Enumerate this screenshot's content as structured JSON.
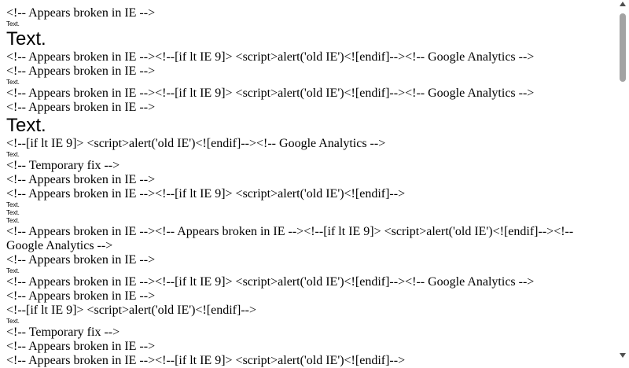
{
  "lines": [
    {
      "style": "serif",
      "text": "<!-- Appears broken in IE -->"
    },
    {
      "style": "tiny",
      "text": "Text."
    },
    {
      "style": "big",
      "text": "Text."
    },
    {
      "style": "serif",
      "text": "<!-- Appears broken in IE --><!--[if lt IE 9]> <script>alert('old IE')<![endif]--><!-- Google Analytics -->"
    },
    {
      "style": "serif",
      "text": "<!-- Appears broken in IE -->"
    },
    {
      "style": "tiny",
      "text": "Text."
    },
    {
      "style": "serif",
      "text": "<!-- Appears broken in IE --><!--[if lt IE 9]> <script>alert('old IE')<![endif]--><!-- Google Analytics -->"
    },
    {
      "style": "serif",
      "text": "<!-- Appears broken in IE -->"
    },
    {
      "style": "big",
      "text": "Text."
    },
    {
      "style": "serif",
      "text": "<!--[if lt IE 9]> <script>alert('old IE')<![endif]--><!-- Google Analytics -->"
    },
    {
      "style": "tiny",
      "text": "Text."
    },
    {
      "style": "serif",
      "text": "<!-- Temporary fix -->"
    },
    {
      "style": "serif",
      "text": "<!-- Appears broken in IE -->"
    },
    {
      "style": "serif",
      "text": "<!-- Appears broken in IE --><!--[if lt IE 9]> <script>alert('old IE')<![endif]-->"
    },
    {
      "style": "tiny",
      "text": "Text."
    },
    {
      "style": "tiny",
      "text": "Text."
    },
    {
      "style": "tiny",
      "text": "Text."
    },
    {
      "style": "serif",
      "text": "<!-- Appears broken in IE --><!-- Appears broken in IE --><!--[if lt IE 9]> <script>alert('old IE')<![endif]--><!-- Google Analytics -->"
    },
    {
      "style": "serif",
      "text": "<!-- Appears broken in IE -->"
    },
    {
      "style": "tiny",
      "text": "Text."
    },
    {
      "style": "serif",
      "text": "<!-- Appears broken in IE --><!--[if lt IE 9]> <script>alert('old IE')<![endif]--><!-- Google Analytics -->"
    },
    {
      "style": "serif",
      "text": "<!-- Appears broken in IE -->"
    },
    {
      "style": "serif",
      "text": "<!--[if lt IE 9]> <script>alert('old IE')<![endif]-->"
    },
    {
      "style": "tiny",
      "text": "Text."
    },
    {
      "style": "serif",
      "text": "<!-- Temporary fix -->"
    },
    {
      "style": "serif",
      "text": "<!-- Appears broken in IE -->"
    },
    {
      "style": "serif",
      "text": "<!-- Appears broken in IE --><!--[if lt IE 9]> <script>alert('old IE')<![endif]-->"
    }
  ],
  "scrollbar": {
    "up_icon": "arrow-up-icon",
    "down_icon": "arrow-down-icon"
  }
}
